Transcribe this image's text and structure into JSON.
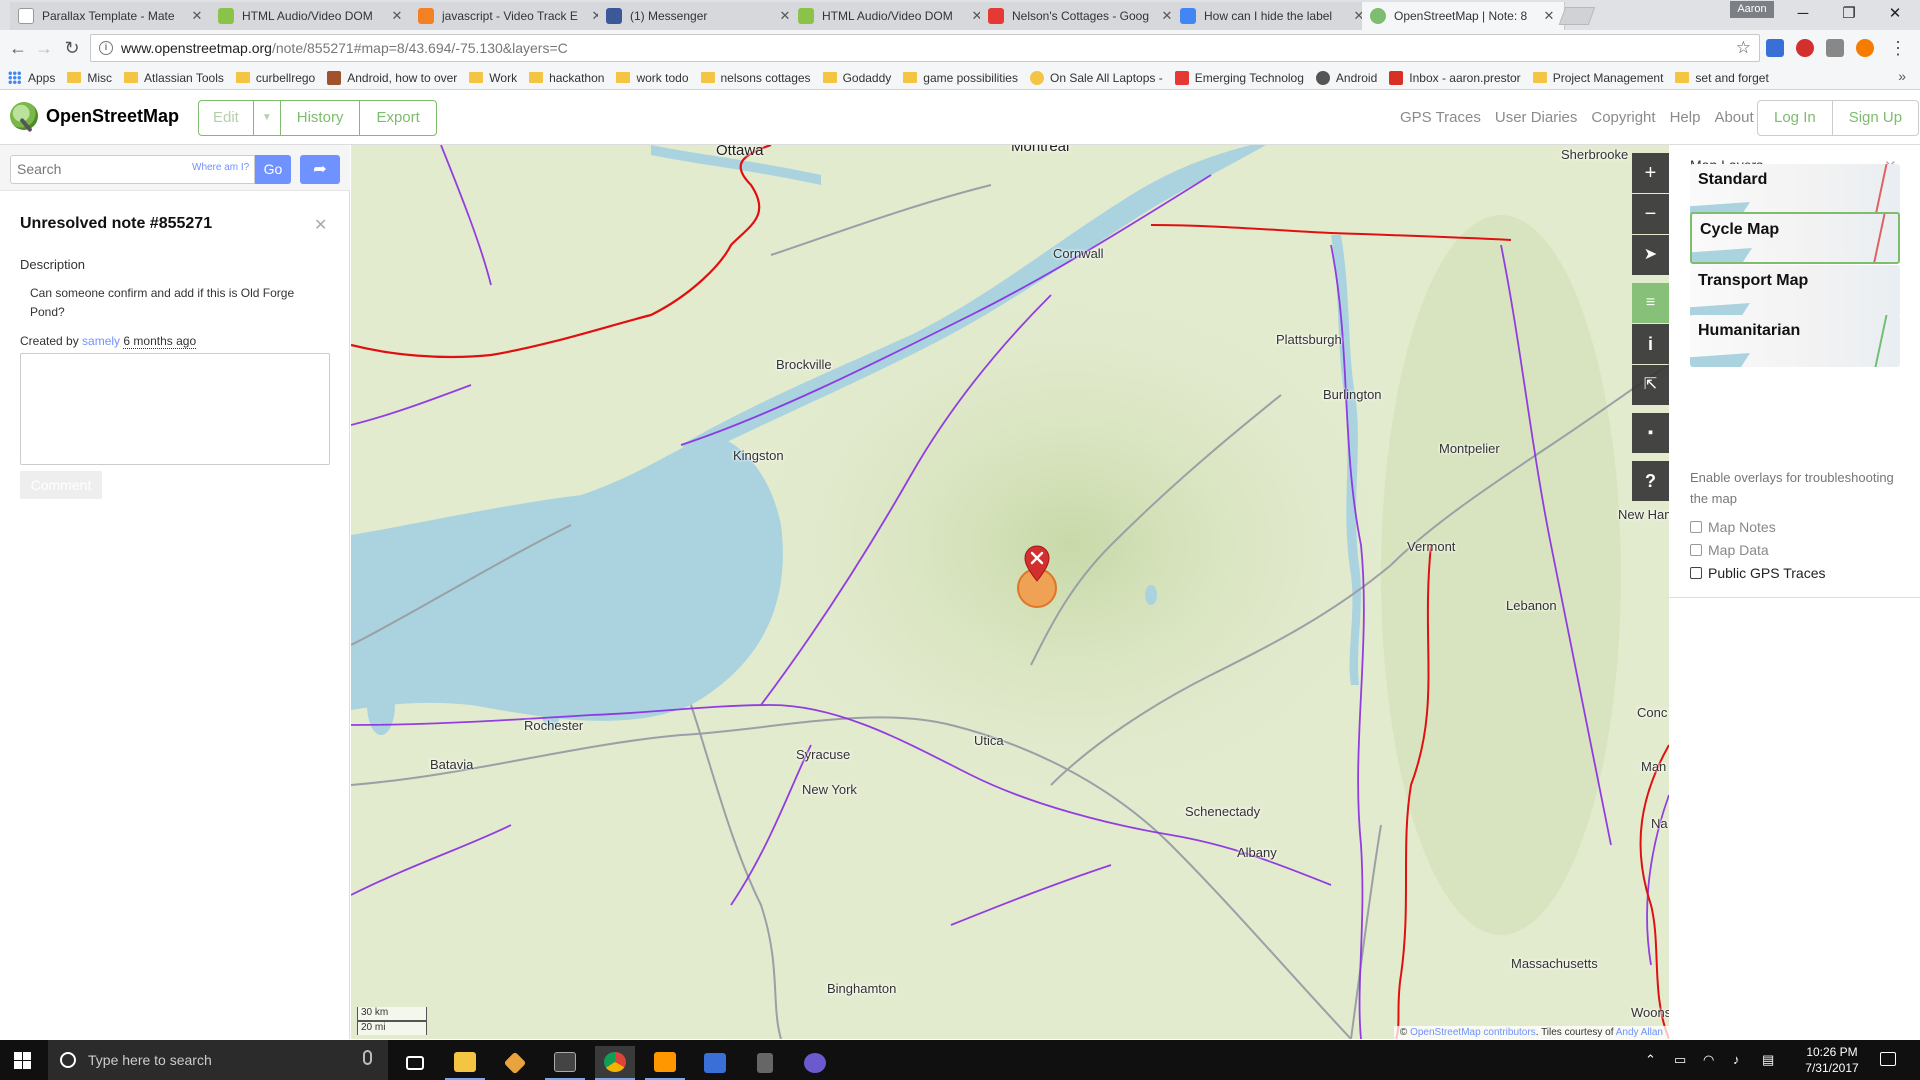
{
  "browser": {
    "tabs": [
      {
        "title": "Parallax Template - Mate",
        "color": "#9e9e9e"
      },
      {
        "title": "HTML Audio/Video DOM",
        "color": "#8bc34a"
      },
      {
        "title": "javascript - Video Track E",
        "color": "#f48024"
      },
      {
        "title": "(1) Messenger",
        "color": "#3b5998"
      },
      {
        "title": "HTML Audio/Video DOM",
        "color": "#8bc34a"
      },
      {
        "title": "Nelson's Cottages - Goog",
        "color": "#e53935"
      },
      {
        "title": "How can I hide the label",
        "color": "#4285f4"
      },
      {
        "title": "OpenStreetMap | Note: 8",
        "color": "#7ebc6f"
      }
    ],
    "profile": "Aaron",
    "url_host": "www.openstreetmap.org",
    "url_path": "/note/855271#map=8/43.694/-75.130&layers=C"
  },
  "bookmarks": [
    {
      "label": "Apps",
      "kind": "apps"
    },
    {
      "label": "Misc",
      "kind": "folder"
    },
    {
      "label": "Atlassian Tools",
      "kind": "folder"
    },
    {
      "label": "curbellrego",
      "kind": "folder"
    },
    {
      "label": "Android, how to over",
      "kind": "page",
      "color": "#a0522d"
    },
    {
      "label": "Work",
      "kind": "folder"
    },
    {
      "label": "hackathon",
      "kind": "folder"
    },
    {
      "label": "work todo",
      "kind": "folder"
    },
    {
      "label": "nelsons cottages",
      "kind": "folder"
    },
    {
      "label": "Godaddy",
      "kind": "folder"
    },
    {
      "label": "game possibilities",
      "kind": "folder"
    },
    {
      "label": "On Sale All Laptops -",
      "kind": "page",
      "color": "#f4c542"
    },
    {
      "label": "Emerging Technolog",
      "kind": "page",
      "color": "#e53935"
    },
    {
      "label": "Android",
      "kind": "page",
      "color": "#555555"
    },
    {
      "label": "Inbox - aaron.prestor",
      "kind": "page",
      "color": "#d93025"
    },
    {
      "label": "Project Management",
      "kind": "folder"
    },
    {
      "label": "set and forget",
      "kind": "folder"
    }
  ],
  "osm": {
    "brand": "OpenStreetMap",
    "edit": "Edit",
    "history": "History",
    "export": "Export",
    "links": [
      "GPS Traces",
      "User Diaries",
      "Copyright",
      "Help",
      "About"
    ],
    "login": "Log In",
    "signup": "Sign Up"
  },
  "sidebar": {
    "search_placeholder": "Search",
    "where_am_i": "Where am I?",
    "go": "Go",
    "note_title": "Unresolved note #855271",
    "description_heading": "Description",
    "description": "Can someone confirm and add if this is Old Forge Pond?",
    "created_prefix": "Created by",
    "created_user": "samely",
    "created_ago": "6 months ago",
    "comment_button": "Comment"
  },
  "map": {
    "labels": [
      {
        "text": "Ottawa",
        "big": true
      },
      {
        "text": "Montreal",
        "big": true
      },
      {
        "text": "Sherbrooke"
      },
      {
        "text": "Cornwall"
      },
      {
        "text": "Plattsburgh"
      },
      {
        "text": "Brockville"
      },
      {
        "text": "Burlington"
      },
      {
        "text": "Kingston"
      },
      {
        "text": "Montpelier"
      },
      {
        "text": "New Ham"
      },
      {
        "text": "Vermont"
      },
      {
        "text": "Lebanon"
      },
      {
        "text": "Rochester"
      },
      {
        "text": "Batavia"
      },
      {
        "text": "Syracuse"
      },
      {
        "text": "Utica"
      },
      {
        "text": "New York"
      },
      {
        "text": "Conc"
      },
      {
        "text": "Man"
      },
      {
        "text": "Schenectady"
      },
      {
        "text": "Na"
      },
      {
        "text": "Albany"
      },
      {
        "text": "Binghamton"
      },
      {
        "text": "Massachusetts"
      },
      {
        "text": "Woons"
      }
    ],
    "scale_km": "30 km",
    "scale_mi": "20 mi",
    "attribution_prefix": "©",
    "attribution_osm": "OpenStreetMap contributors",
    "attribution_mid": ". Tiles courtesy of",
    "attribution_tiles": "Andy Allan"
  },
  "layers": {
    "title": "Map Layers",
    "items": [
      {
        "name": "Standard",
        "active": false
      },
      {
        "name": "Cycle Map",
        "active": true
      },
      {
        "name": "Transport Map",
        "active": false
      },
      {
        "name": "Humanitarian",
        "active": false
      }
    ],
    "overlay_text": "Enable overlays for troubleshooting the map",
    "overlays": [
      {
        "name": "Map Notes",
        "enabled": false
      },
      {
        "name": "Map Data",
        "enabled": false
      },
      {
        "name": "Public GPS Traces",
        "enabled": true
      }
    ]
  },
  "taskbar": {
    "search": "Type here to search",
    "time": "10:26 PM",
    "date": "7/31/2017"
  },
  "colors": {
    "osm_green": "#7ebc6f",
    "osm_blue": "#7092ff",
    "water": "#aad3df",
    "cycle_route": "#8a2be2",
    "border": "#e01010"
  }
}
